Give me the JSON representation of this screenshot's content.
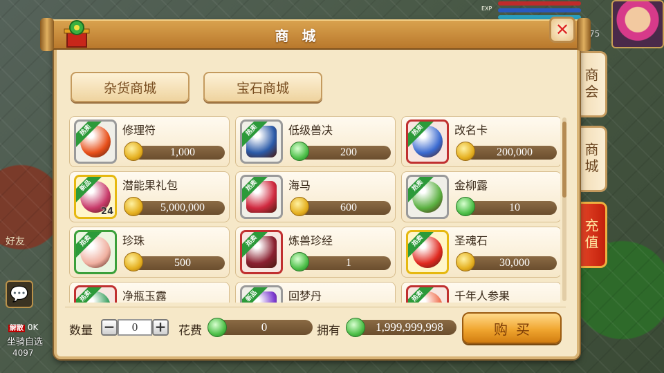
{
  "hud": {
    "exp_label": "EXP",
    "right_number": "75"
  },
  "left_hud": {
    "friend_label": "好友",
    "ok_tag": "解散",
    "ok_text": "0K",
    "mount_label": "坐骑自选",
    "mount_number": "4097"
  },
  "window": {
    "title": "商 城",
    "close_label": "✕"
  },
  "categories": [
    {
      "label": "杂货商城"
    },
    {
      "label": "宝石商城"
    }
  ],
  "side_tabs": [
    {
      "label": "商会",
      "active": false
    },
    {
      "label": "商城",
      "active": false
    },
    {
      "label": "充值",
      "active": true
    }
  ],
  "items": [
    {
      "name": "修理符",
      "price": "1,000",
      "currency": "coin",
      "badge": "热卖",
      "frame": "gray",
      "color": "#e8501a",
      "qty": ""
    },
    {
      "name": "低级兽决",
      "price": "200",
      "currency": "jade",
      "badge": "热卖",
      "frame": "gray",
      "color": "#2a5aa8",
      "qty": ""
    },
    {
      "name": "改名卡",
      "price": "200,000",
      "currency": "coin",
      "badge": "热卖",
      "frame": "red",
      "color": "#3a6ad0",
      "qty": ""
    },
    {
      "name": "潜能果礼包",
      "price": "5,000,000",
      "currency": "coin",
      "badge": "新品",
      "frame": "gold",
      "color": "#c83a6a",
      "qty": "24"
    },
    {
      "name": "海马",
      "price": "600",
      "currency": "coin",
      "badge": "热卖",
      "frame": "gray",
      "color": "#d02a40",
      "qty": ""
    },
    {
      "name": "金柳露",
      "price": "10",
      "currency": "jade",
      "badge": "热卖",
      "frame": "gray",
      "color": "#5ab040",
      "qty": ""
    },
    {
      "name": "珍珠",
      "price": "500",
      "currency": "coin",
      "badge": "热卖",
      "frame": "green",
      "color": "#f0b0a0",
      "qty": ""
    },
    {
      "name": "炼兽珍经",
      "price": "1",
      "currency": "jade",
      "badge": "热卖",
      "frame": "red",
      "color": "#8a2030",
      "qty": ""
    },
    {
      "name": "圣魂石",
      "price": "30,000",
      "currency": "coin",
      "badge": "热卖",
      "frame": "gold",
      "color": "#e02a20",
      "qty": ""
    },
    {
      "name": "净瓶玉露",
      "price": "",
      "currency": "jade",
      "badge": "热卖",
      "frame": "red",
      "color": "#3aa060",
      "qty": ""
    },
    {
      "name": "回梦丹",
      "price": "",
      "currency": "jade",
      "badge": "新品",
      "frame": "gray",
      "color": "#7a3ad0",
      "qty": ""
    },
    {
      "name": "千年人参果",
      "price": "",
      "currency": "coin",
      "badge": "热卖",
      "frame": "red",
      "color": "#f07050",
      "qty": ""
    }
  ],
  "footer": {
    "quantity_label": "数量",
    "minus_label": "−",
    "plus_label": "+",
    "quantity_value": "0",
    "cost_label": "花费",
    "cost_value": "0",
    "owned_label": "拥有",
    "owned_value": "1,999,999,998",
    "buy_label": "购买"
  },
  "colors": {
    "panel_bg": "#f6e8c8",
    "title_bar": "#c98c3a",
    "active_tab": "#d83418",
    "price_bar": "#7a5a38",
    "buy_button": "#f0a630"
  }
}
